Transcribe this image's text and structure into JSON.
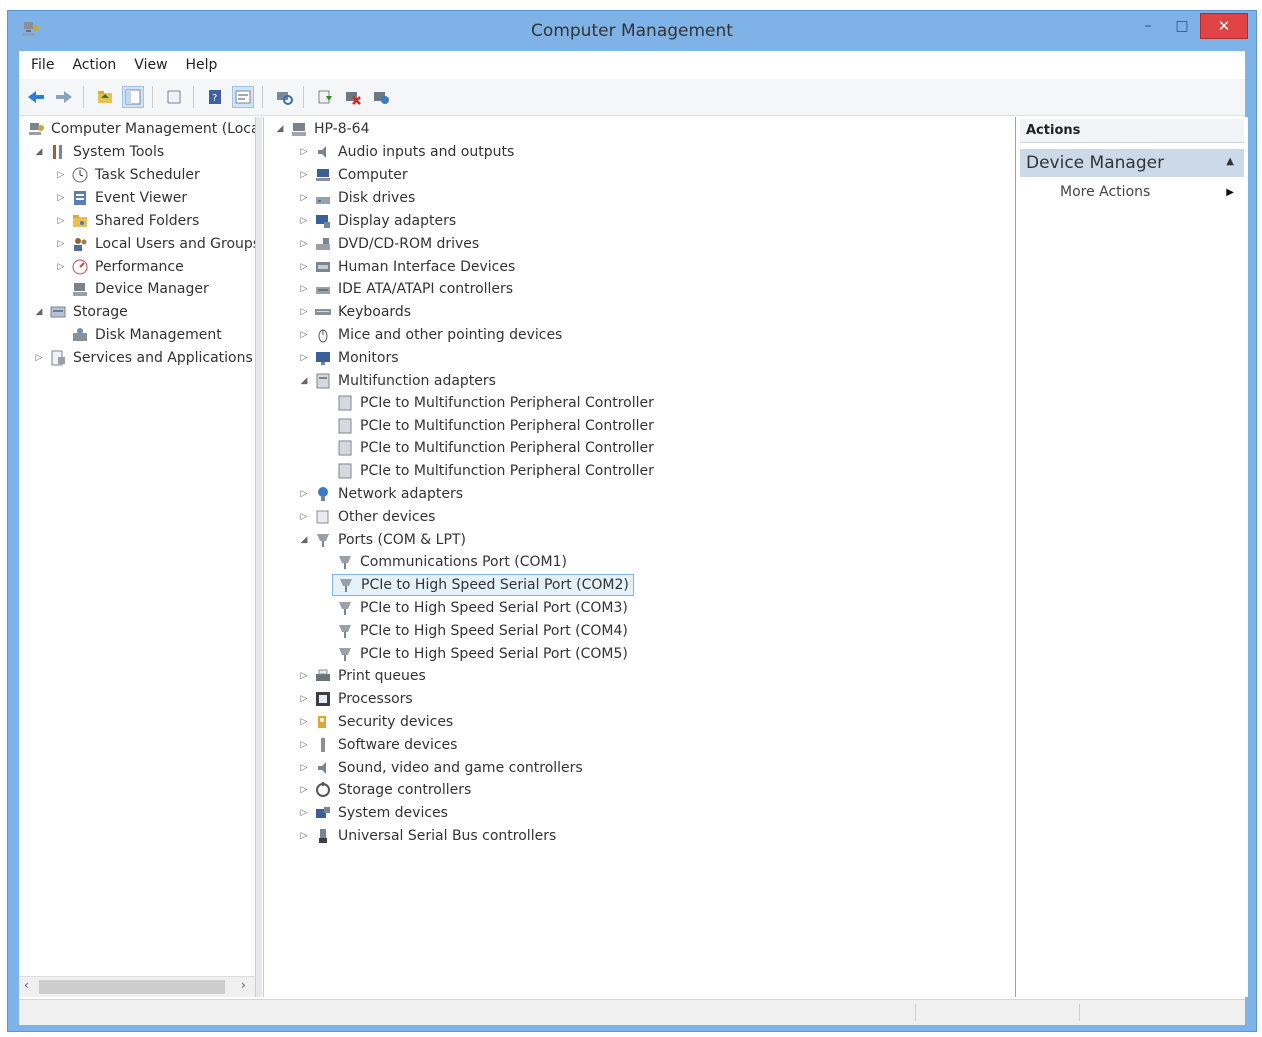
{
  "window": {
    "title": "Computer Management",
    "controls": {
      "minimize": "–",
      "maximize": "□",
      "close": "✕"
    }
  },
  "menu": [
    "File",
    "Action",
    "View",
    "Help"
  ],
  "toolbar": {
    "buttons": [
      "back-icon",
      "forward-icon",
      "up-folder-icon",
      "show-hide-tree-icon",
      "export-list-icon",
      "help-icon",
      "properties-icon",
      "scan-hardware-icon",
      "update-driver-icon",
      "disable-device-icon",
      "uninstall-device-icon"
    ]
  },
  "left_tree": {
    "root": "Computer Management (Local",
    "system_tools": "System Tools",
    "task_scheduler": "Task Scheduler",
    "event_viewer": "Event Viewer",
    "shared_folders": "Shared Folders",
    "local_users": "Local Users and Groups",
    "performance": "Performance",
    "device_manager": "Device Manager",
    "storage": "Storage",
    "disk_management": "Disk Management",
    "services": "Services and Applications"
  },
  "devices": {
    "root": "HP-8-64",
    "audio": "Audio inputs and outputs",
    "computer": "Computer",
    "disk": "Disk drives",
    "display": "Display adapters",
    "dvd": "DVD/CD-ROM drives",
    "hid": "Human Interface Devices",
    "ide": "IDE ATA/ATAPI controllers",
    "keyboards": "Keyboards",
    "mice": "Mice and other pointing devices",
    "monitors": "Monitors",
    "multifunction": "Multifunction adapters",
    "mf_child": "PCIe to Multifunction Peripheral Controller",
    "network": "Network adapters",
    "other": "Other devices",
    "ports": "Ports (COM & LPT)",
    "com1": "Communications Port (COM1)",
    "com2": "PCIe to High Speed Serial Port (COM2)",
    "com3": "PCIe to High Speed Serial Port (COM3)",
    "com4": "PCIe to High Speed Serial Port (COM4)",
    "com5": "PCIe to High Speed Serial Port (COM5)",
    "print": "Print queues",
    "processors": "Processors",
    "security": "Security devices",
    "software": "Software devices",
    "sound": "Sound, video and game controllers",
    "storage_ctrl": "Storage controllers",
    "system": "System devices",
    "usb": "Universal Serial Bus controllers"
  },
  "actions": {
    "header": "Actions",
    "group": "Device Manager",
    "more": "More Actions"
  }
}
